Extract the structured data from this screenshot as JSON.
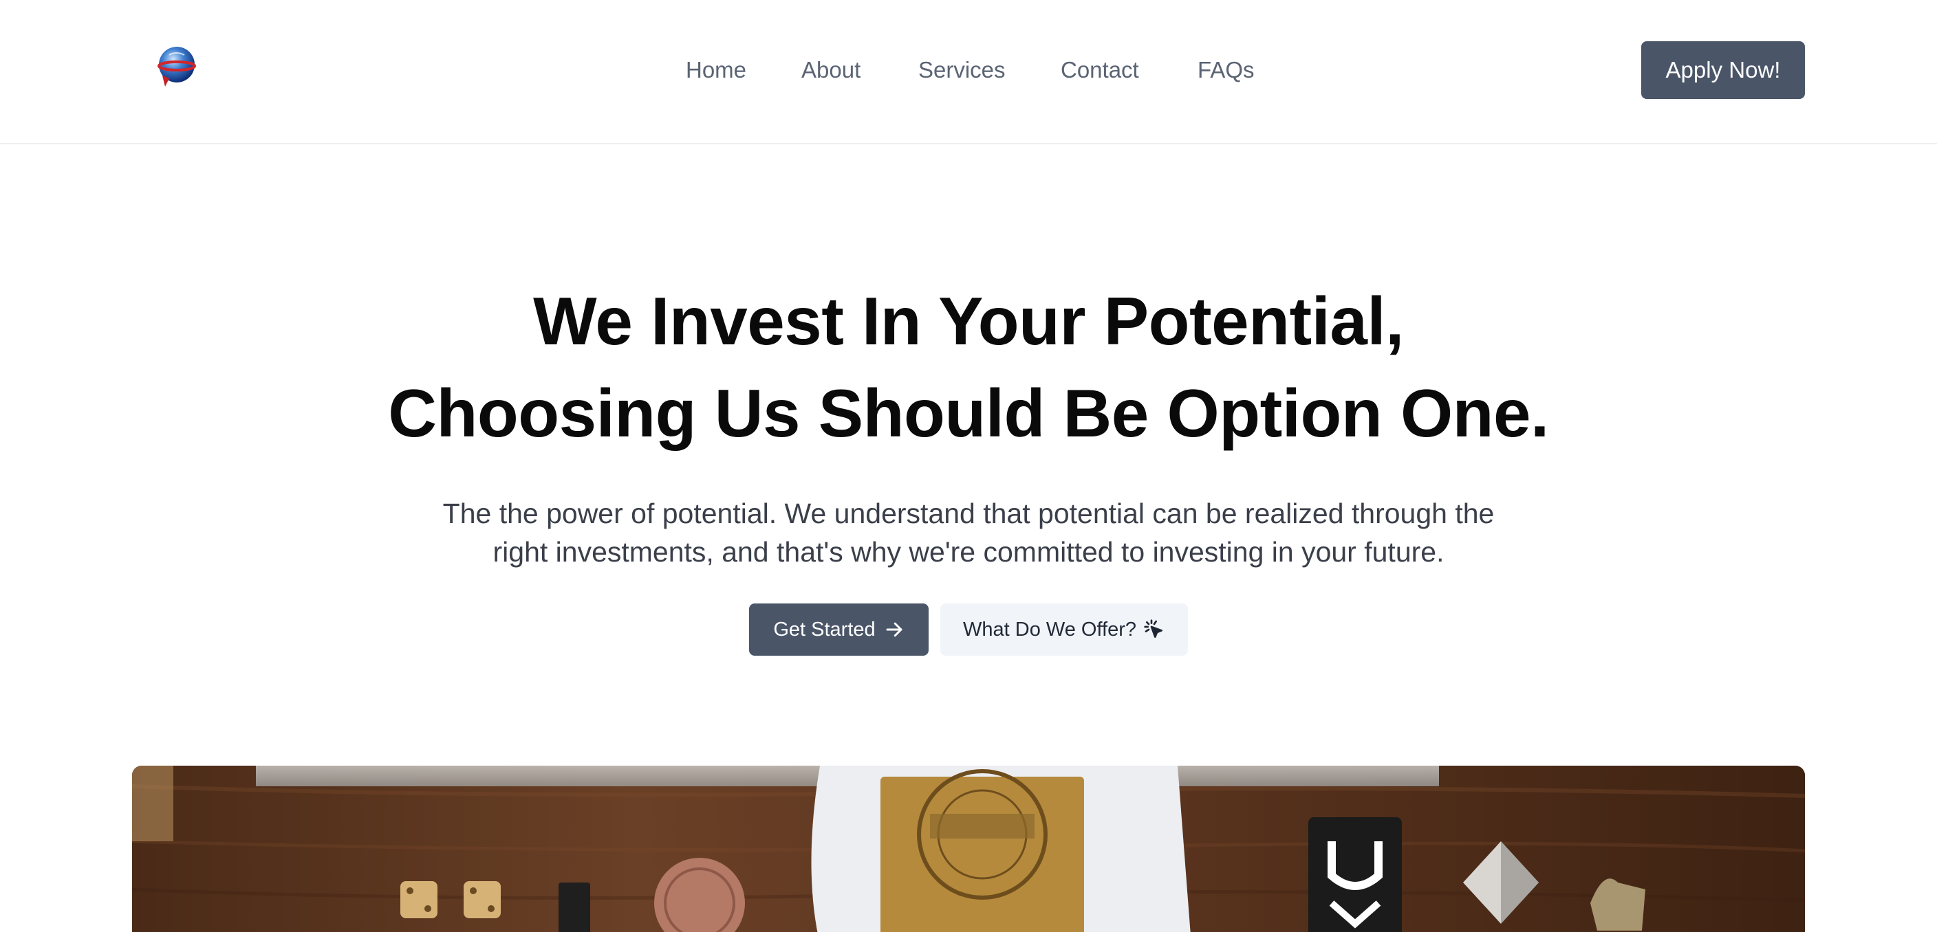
{
  "header": {
    "logo_icon": "globe-logo-icon",
    "nav": [
      {
        "label": "Home"
      },
      {
        "label": "About"
      },
      {
        "label": "Services"
      },
      {
        "label": "Contact"
      },
      {
        "label": "FAQs"
      }
    ],
    "cta_label": "Apply Now!"
  },
  "hero": {
    "title_line1": "We Invest In Your Potential,",
    "title_line2": "Choosing Us Should Be Option One.",
    "subtitle_line1": "The the power of potential. We understand that potential can be realized through the",
    "subtitle_line2": "right investments, and that's why we're committed to investing in your future.",
    "primary_button": {
      "label": "Get Started",
      "icon": "arrow-right-icon"
    },
    "secondary_button": {
      "label": "What Do We Offer?",
      "icon": "cursor-click-icon"
    }
  },
  "colors": {
    "button_dark": "#4a5568",
    "button_light": "#f1f4f9",
    "nav_text": "#5b6474"
  },
  "image": {
    "icon": "desk-items-photo"
  }
}
